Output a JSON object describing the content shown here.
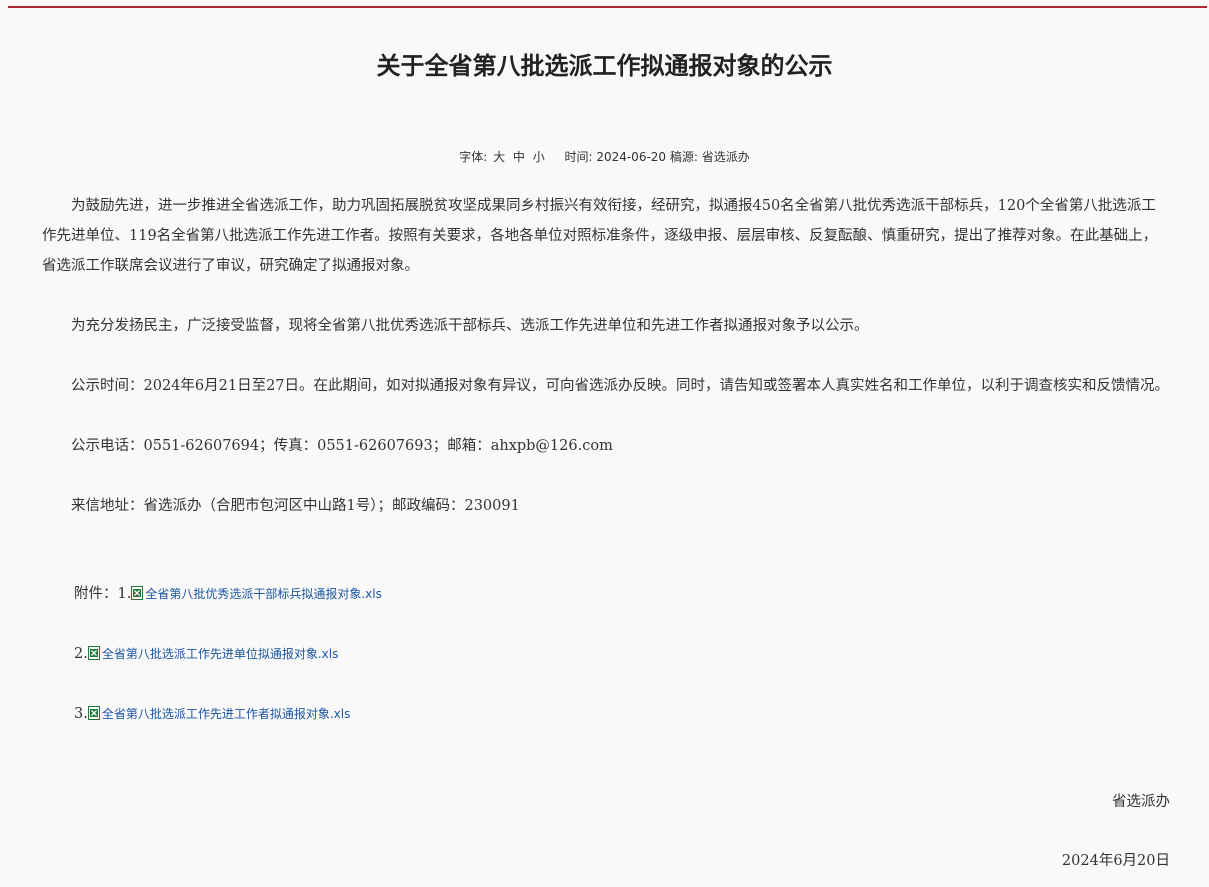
{
  "article": {
    "title": "关于全省第八批选派工作拟通报对象的公示",
    "meta": {
      "font_label": "字体:",
      "size_large": "大",
      "size_medium": "中",
      "size_small": "小",
      "time_label": "时间:",
      "time_value": "2024-06-20",
      "source_label": "稿源:",
      "source_value": "省选派办"
    },
    "paragraphs": [
      "为鼓励先进，进一步推进全省选派工作，助力巩固拓展脱贫攻坚成果同乡村振兴有效衔接，经研究，拟通报450名全省第八批优秀选派干部标兵，120个全省第八批选派工作先进单位、119名全省第八批选派工作先进工作者。按照有关要求，各地各单位对照标准条件，逐级申报、层层审核、反复酝酿、慎重研究，提出了推荐对象。在此基础上，省选派工作联席会议进行了审议，研究确定了拟通报对象。",
      "为充分发扬民主，广泛接受监督，现将全省第八批优秀选派干部标兵、选派工作先进单位和先进工作者拟通报对象予以公示。",
      "公示时间：2024年6月21日至27日。在此期间，如对拟通报对象有异议，可向省选派办反映。同时，请告知或签署本人真实姓名和工作单位，以利于调查核实和反馈情况。",
      "公示电话：0551-62607694；传真：0551-62607693；邮箱：ahxpb@126.com",
      "来信地址：省选派办（合肥市包河区中山路1号）；邮政编码：230091"
    ],
    "attachments_label": "附件：",
    "attachments": [
      {
        "num": "1.",
        "name": "全省第八批优秀选派干部标兵拟通报对象.xls"
      },
      {
        "num": "2.",
        "name": "全省第八批选派工作先进单位拟通报对象.xls"
      },
      {
        "num": "3.",
        "name": "全省第八批选派工作先进工作者拟通报对象.xls"
      }
    ],
    "signature": "省选派办",
    "date": "2024年6月20日"
  },
  "colors": {
    "top_line": "#b2282f",
    "link": "#1c56a3",
    "background": "#f9f9f9",
    "excel_icon": "#1f7a3a"
  },
  "icons": [
    "excel-file-icon"
  ]
}
